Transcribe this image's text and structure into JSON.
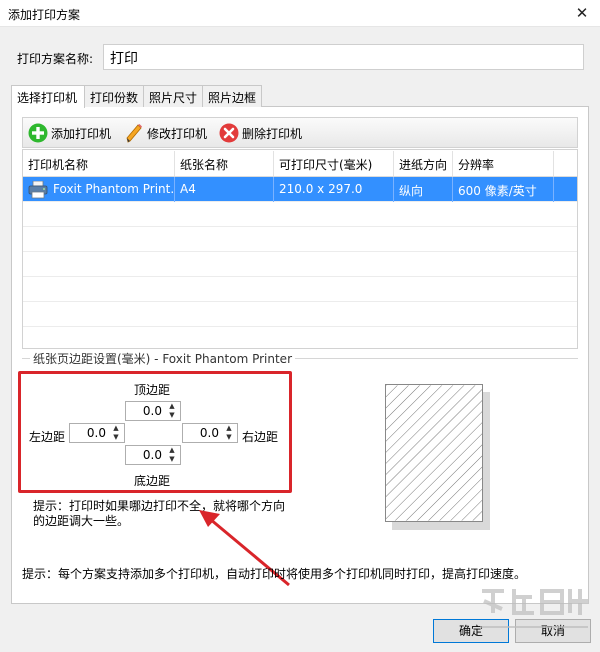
{
  "window": {
    "title": "添加打印方案",
    "close_glyph": "✕"
  },
  "form": {
    "name_label": "打印方案名称:",
    "name_value": "打印"
  },
  "tabs": [
    {
      "label": "选择打印机",
      "active": true
    },
    {
      "label": "打印份数",
      "active": false
    },
    {
      "label": "照片尺寸",
      "active": false
    },
    {
      "label": "照片边框",
      "active": false
    }
  ],
  "toolbar": {
    "add_label": "添加打印机",
    "edit_label": "修改打印机",
    "delete_label": "删除打印机",
    "icons": {
      "add": "plus-circle-icon",
      "edit": "pencil-icon",
      "delete": "x-circle-icon"
    }
  },
  "printer_table": {
    "headers": [
      "打印机名称",
      "纸张名称",
      "可打印尺寸(毫米)",
      "进纸方向",
      "分辨率"
    ],
    "rows": [
      [
        "Foxit Phantom Print...",
        "A4",
        "210.0 x 297.0",
        "纵向",
        "600 像素/英寸"
      ]
    ]
  },
  "margins": {
    "group_title": "纸张页边距设置(毫米) - Foxit Phantom Printer",
    "top_label": "顶边距",
    "top_value": "0.0",
    "left_label": "左边距",
    "left_value": "0.0",
    "right_label": "右边距",
    "right_value": "0.0",
    "bottom_label": "底边距",
    "bottom_value": "0.0",
    "spin_arrows": "▲\n▼",
    "hint": "提示：打印时如果哪边打印不全，就将哪个方向的边距调大一些。"
  },
  "footer": {
    "hint": "提示：每个方案支持添加多个打印机，自动打印时将使用多个打印机同时打印，提高打印速度。",
    "ok_label": "确定",
    "cancel_label": "取消"
  },
  "colors": {
    "selection": "#3390ff",
    "highlight_box": "#d9252a",
    "add_icon": "#2eb82e",
    "delete_icon": "#e23b3b"
  }
}
